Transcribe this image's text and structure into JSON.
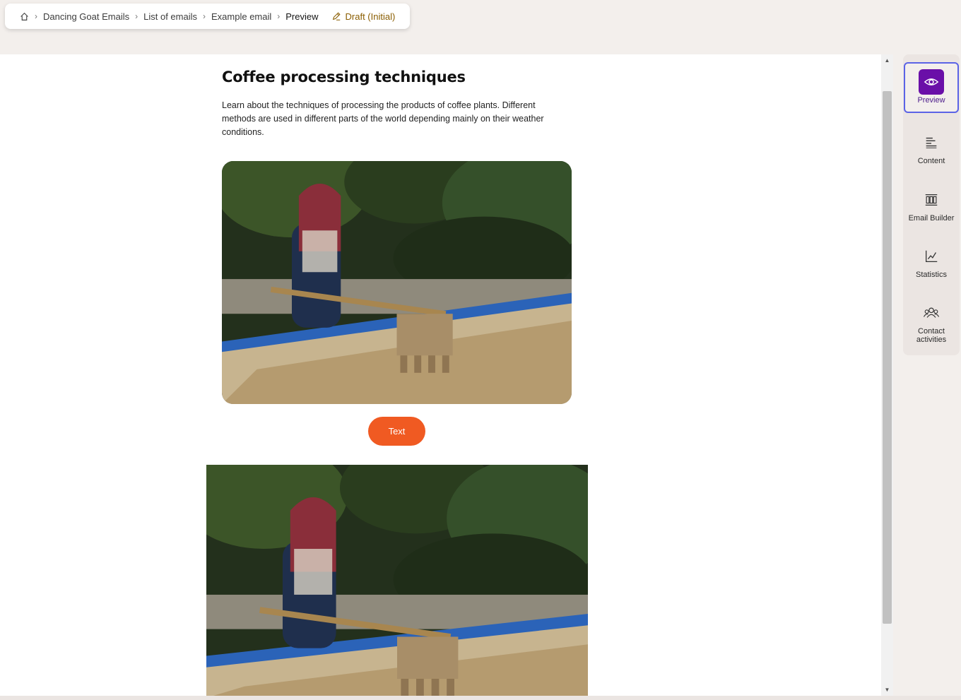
{
  "breadcrumb": {
    "home_icon": "home-icon",
    "items": [
      "Dancing Goat Emails",
      "List of emails",
      "Example email"
    ],
    "current": "Preview",
    "status": "Draft (Initial)",
    "status_icon": "pencil-icon",
    "status_color": "#8a5d00"
  },
  "email": {
    "title": "Coffee processing techniques",
    "lead": "Learn about the techniques of processing the products of coffee plants. Different methods are used in different parts of the world depending mainly on their weather conditions.",
    "button_label": "Text",
    "button_color": "#f05a22"
  },
  "rail": {
    "tabs": [
      {
        "label": "Preview",
        "icon": "eye-icon",
        "active": true
      },
      {
        "label": "Content",
        "icon": "content-lines-icon"
      },
      {
        "label": "Email Builder",
        "icon": "columns-icon"
      },
      {
        "label": "Statistics",
        "icon": "chart-icon"
      },
      {
        "label": "Contact activities",
        "icon": "people-icon"
      }
    ],
    "active_color": "#6a0fa8"
  }
}
